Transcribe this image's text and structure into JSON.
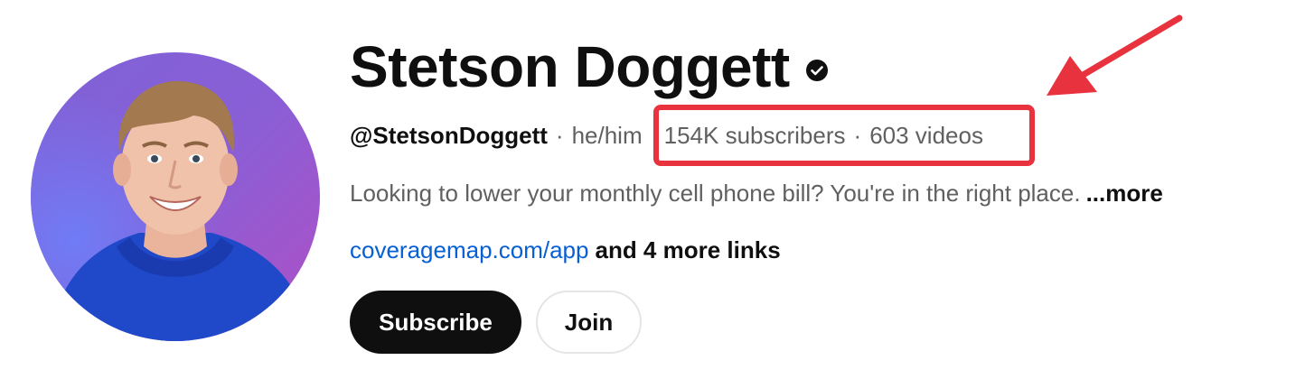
{
  "channel": {
    "name": "Stetson Doggett",
    "verified_icon": "verified-check-icon",
    "handle": "@StetsonDoggett",
    "pronouns": "he/him",
    "separator": "·",
    "subscribers": "154K subscribers",
    "videos": "603 videos",
    "description": "Looking to lower your monthly cell phone bill? You're in the right place.",
    "more_label": "...more",
    "link_url": "coveragemap.com/app",
    "link_more": "and 4 more links"
  },
  "buttons": {
    "subscribe_label": "Subscribe",
    "join_label": "Join"
  },
  "annotation": {
    "highlight_color": "#e8333f",
    "arrow_icon": "red-arrow-icon"
  },
  "colors": {
    "link": "#065fd4",
    "secondary_text": "#606060",
    "primary_text": "#0f0f0f"
  }
}
